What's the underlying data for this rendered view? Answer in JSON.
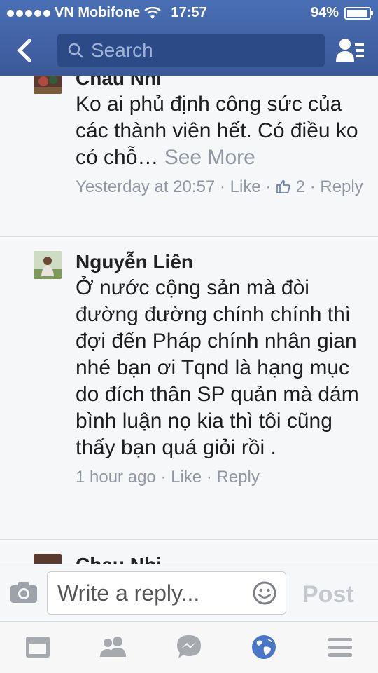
{
  "status_bar": {
    "carrier": "VN Mobifone",
    "time": "17:57",
    "battery_text": "94%",
    "battery_level": 0.94
  },
  "nav": {
    "search_placeholder": "Search"
  },
  "comments": [
    {
      "name": "Chau Nhi",
      "text": "Ko ai phủ định công sức của các thành viên hết. Có điều ko có chỗ…",
      "see_more": "See More",
      "time": "Yesterday at 20:57",
      "like_label": "Like",
      "like_count": "2",
      "reply_label": "Reply",
      "separator": "·"
    },
    {
      "name": "Nguyễn Liên",
      "text": "Ở nước cộng sản mà đòi đường đường chính chính thì đợi đến Pháp chính nhân gian nhé bạn ơi Tqnd là hạng mục do đích thân SP quản mà dám bình luận nọ kia thì tôi cũng thấy bạn quá giỏi rồi .",
      "time": "1 hour ago",
      "like_label": "Like",
      "reply_label": "Reply",
      "separator": "·"
    },
    {
      "name": "Chau Nhi"
    }
  ],
  "composer": {
    "placeholder": "Write a reply...",
    "post_label": "Post"
  },
  "colors": {
    "brand_blue": "#3b5998",
    "muted_text": "#9197a3",
    "active_tab": "#4a76c8",
    "inactive_tab": "#a6a9ae"
  },
  "icons": {
    "back": "chevron-left-icon",
    "search": "search-icon",
    "friends": "friend-requests-icon",
    "camera": "camera-icon",
    "emoji": "smiley-icon",
    "tabs": [
      "news-feed-icon",
      "friends-icon",
      "messages-icon",
      "globe-icon",
      "menu-icon"
    ]
  }
}
